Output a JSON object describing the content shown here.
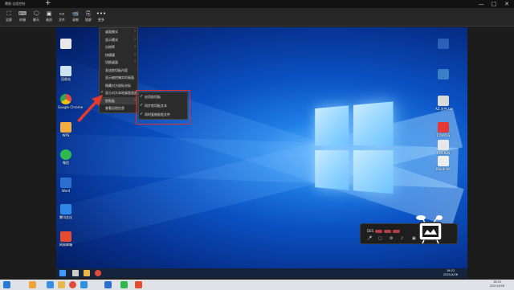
{
  "app": {
    "title": "鹰眼·远程控制",
    "new_tab": "+",
    "window_buttons": [
      "—",
      "□",
      "✕"
    ]
  },
  "toolbar": [
    {
      "name": "fullscreen",
      "label": "全屏",
      "icon": "⛶"
    },
    {
      "name": "terminal",
      "label": "终端",
      "icon": "⌨"
    },
    {
      "name": "monitor",
      "label": "聊天",
      "icon": "🗨"
    },
    {
      "name": "screenshot",
      "label": "画质",
      "icon": "▣"
    },
    {
      "name": "file",
      "label": "文件",
      "icon": "▭"
    },
    {
      "name": "record",
      "label": "录制",
      "icon": "📹"
    },
    {
      "name": "lock",
      "label": "锁屏",
      "icon": "⎘"
    },
    {
      "name": "more",
      "label": "更多",
      "icon": "•••"
    }
  ],
  "menu": [
    {
      "label": "桌面模式",
      "arrow": true,
      "checked": false
    },
    {
      "label": "显示模式",
      "arrow": true,
      "checked": false
    },
    {
      "label": "分辨率",
      "arrow": true,
      "checked": false
    },
    {
      "label": "快捷键",
      "arrow": true,
      "checked": false
    },
    {
      "label": "切换桌面",
      "arrow": true,
      "checked": false
    },
    {
      "label": "发送剪切板内容",
      "arrow": false,
      "checked": false
    },
    {
      "label": "显示被控端实时画面",
      "arrow": false,
      "checked": false
    },
    {
      "label": "隐藏对方鼠标光标",
      "arrow": false,
      "checked": false
    },
    {
      "label": "显示对方本地桌面画面",
      "arrow": false,
      "checked": true
    },
    {
      "label": "剪贴板",
      "arrow": true,
      "checked": false,
      "highlight": true
    },
    {
      "label": "查看远程信息",
      "arrow": false,
      "checked": false
    }
  ],
  "submenu": [
    {
      "label": "启用剪切板",
      "checked": true
    },
    {
      "label": "同步剪切板文本",
      "checked": true
    },
    {
      "label": "同时复制粘贴文件",
      "checked": true
    }
  ],
  "desktop_icons": [
    {
      "label": "",
      "color": "#e8e8e8"
    },
    {
      "label": "回收站",
      "color": "#cfe3f3"
    },
    {
      "label": "Google Chrome",
      "color": "#e24a3b"
    },
    {
      "label": "WPS",
      "color": "#f2ad3d"
    },
    {
      "label": "微信",
      "color": "#2fb84e"
    },
    {
      "label": "Word",
      "color": "#2b6fd1"
    },
    {
      "label": "腾讯会议",
      "color": "#2e88e8"
    },
    {
      "label": "网易邮箱",
      "color": "#e54b2f"
    }
  ],
  "right_icons": [
    {
      "label": "",
      "color": "#2b5fb8"
    },
    {
      "label": "",
      "color": "#3a7fc5"
    },
    {
      "label": "AZ.文件.tar",
      "color": "#d9d9d9"
    },
    {
      "label": "CDVRSS",
      "color": "#e53935"
    },
    {
      "label": "CDCIGN",
      "color": "#e7e7e7"
    },
    {
      "label": "Blank.txt",
      "color": "#eeeeee"
    }
  ],
  "float_toolbar": {
    "id": "DES",
    "controls": [
      "🎤",
      "▢",
      "⚙",
      "♪",
      "▣",
      "◪"
    ]
  },
  "remote_clock": {
    "time": "16:22",
    "date": "2021/4/26"
  },
  "host_clock": {
    "time": "16:22",
    "date": "2021/4/26"
  },
  "colors": {
    "highlight_box": "#e0302a",
    "arrow": "#e53a2e"
  }
}
